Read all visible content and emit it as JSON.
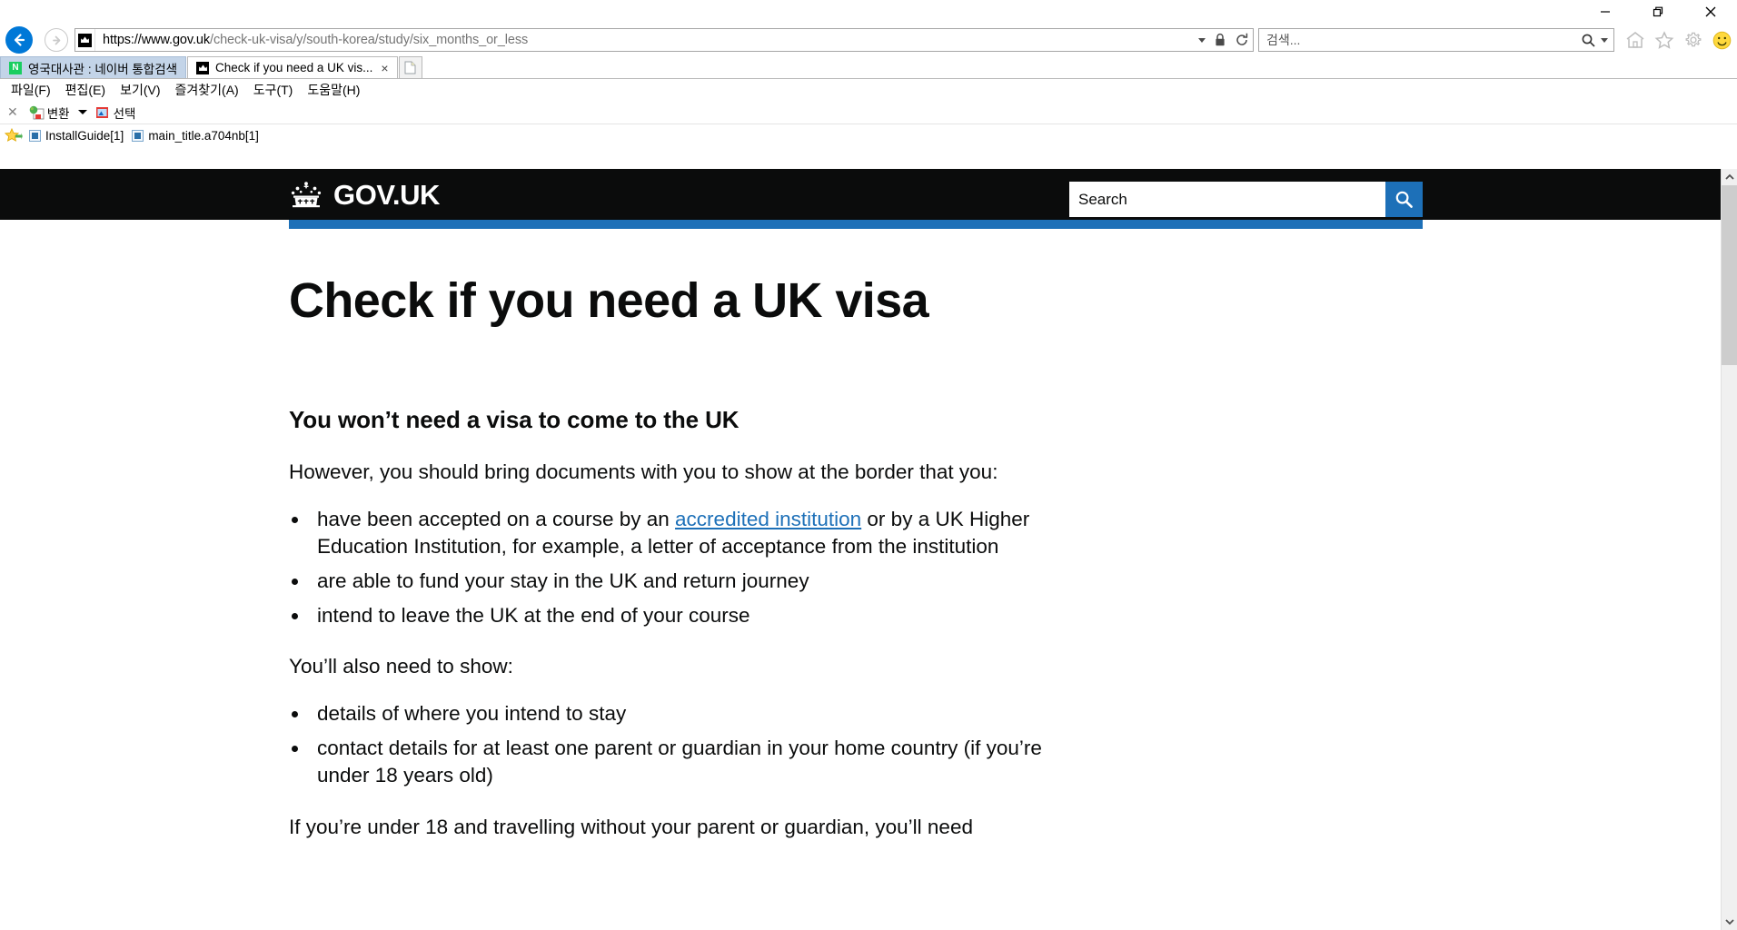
{
  "window": {
    "controls": {
      "minimize": "minimize-button",
      "restore": "restore-button",
      "close": "close-button"
    }
  },
  "browser": {
    "address": {
      "url_domain": "https://www.gov.uk",
      "url_path": "/check-uk-visa/y/south-korea/study/six_months_or_less",
      "site_icon": "crown-icon",
      "dropdown_icon": "chevron-down-icon",
      "lock_icon": "lock-icon",
      "refresh_icon": "refresh-icon"
    },
    "search": {
      "placeholder": "검색...",
      "magnifier_icon": "search-icon",
      "dropdown_icon": "chevron-down-icon"
    },
    "toolbar_icons": {
      "home": "home-icon",
      "favorites": "star-icon",
      "settings": "gear-icon",
      "smiley": "smiley-icon"
    },
    "navigation": {
      "back": "back-arrow-icon",
      "forward": "forward-arrow-icon"
    },
    "tabs": [
      {
        "title": "영국대사관 : 네이버 통합검색",
        "favicon": "naver-icon",
        "active": false
      },
      {
        "title": "Check if you need a UK vis...",
        "favicon": "crown-icon",
        "active": true,
        "close": "×"
      }
    ],
    "new_tab_label": "",
    "menubar": [
      "파일(F)",
      "편집(E)",
      "보기(V)",
      "즐겨찾기(A)",
      "도구(T)",
      "도움말(H)"
    ],
    "ext_toolbar": {
      "close_label": "✕",
      "convert_label": "변환",
      "select_label": "선택"
    },
    "favorites_bar": {
      "star_icon": "favorites-star-icon",
      "items": [
        {
          "label": "InstallGuide[1]",
          "icon": "document-icon"
        },
        {
          "label": "main_title.a704nb[1]",
          "icon": "document-icon"
        }
      ]
    }
  },
  "page": {
    "brand": {
      "crown_icon": "royal-crown-icon",
      "wordmark": "GOV.UK"
    },
    "site_search": {
      "placeholder": "Search",
      "button_icon": "search-icon"
    },
    "title": "Check if you need a UK visa",
    "section_heading": "You won’t need a visa to come to the UK",
    "intro_paragraph": "However, you should bring documents with you to show at the border that you:",
    "bullets_primary": [
      {
        "before": "have been accepted on a course by an ",
        "link": "accredited institution",
        "after": " or by a UK Higher Education Institution, for example, a letter of acceptance from the institution"
      },
      {
        "before": "are able to fund your stay in the UK and return journey",
        "link": "",
        "after": ""
      },
      {
        "before": "intend to leave the UK at the end of your course",
        "link": "",
        "after": ""
      }
    ],
    "secondary_lead": "You’ll also need to show:",
    "bullets_secondary": [
      "details of where you intend to stay",
      "contact details for at least one parent or guardian in your home country (if you’re under 18 years old)"
    ],
    "truncated_paragraph": "If you’re under 18 and travelling without your parent or guardian, you’ll need",
    "colors": {
      "header_black": "#0b0c0c",
      "govuk_blue": "#1d70b8",
      "link_blue": "#1d70b8"
    }
  }
}
